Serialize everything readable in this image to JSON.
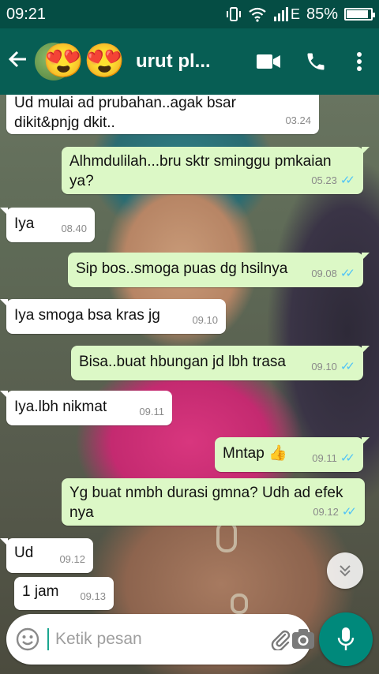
{
  "status_bar": {
    "time": "09:21",
    "network": "E",
    "battery": "85%"
  },
  "header": {
    "title": "urut pl...",
    "emoji_1": "😍",
    "emoji_2": "😍"
  },
  "messages": [
    {
      "dir": "in",
      "text": "Ud mulai ad prubahan..agak bsar dikit&pnjg dkit..",
      "time": "03.24"
    },
    {
      "dir": "out",
      "text": "Alhmdulilah...bru sktr sminggu pmkaian ya?",
      "time": "05.23"
    },
    {
      "dir": "in",
      "text": "Iya",
      "time": "08.40"
    },
    {
      "dir": "out",
      "text": "Sip bos..smoga puas dg hsilnya",
      "time": "09.08"
    },
    {
      "dir": "in",
      "text": "Iya smoga bsa kras jg",
      "time": "09.10"
    },
    {
      "dir": "out",
      "text": "Bisa..buat hbungan jd lbh trasa",
      "time": "09.10"
    },
    {
      "dir": "in",
      "text": "Iya.lbh nikmat",
      "time": "09.11"
    },
    {
      "dir": "out",
      "text": "Mntap 👍",
      "time": "09.11"
    },
    {
      "dir": "out",
      "text": "Yg buat nmbh durasi gmna? Udh ad efek nya",
      "time": "09.12"
    },
    {
      "dir": "in",
      "text": "Ud",
      "time": "09.12"
    },
    {
      "dir": "in",
      "text": "1 jam",
      "time": "09.13"
    }
  ],
  "composer": {
    "placeholder": "Ketik pesan"
  },
  "colors": {
    "header": "#075e54",
    "statusbar": "#054d44",
    "outgoing": "#dcf8c6",
    "incoming": "#ffffff",
    "read_ticks": "#4fc3f7",
    "fab": "#00897b"
  }
}
